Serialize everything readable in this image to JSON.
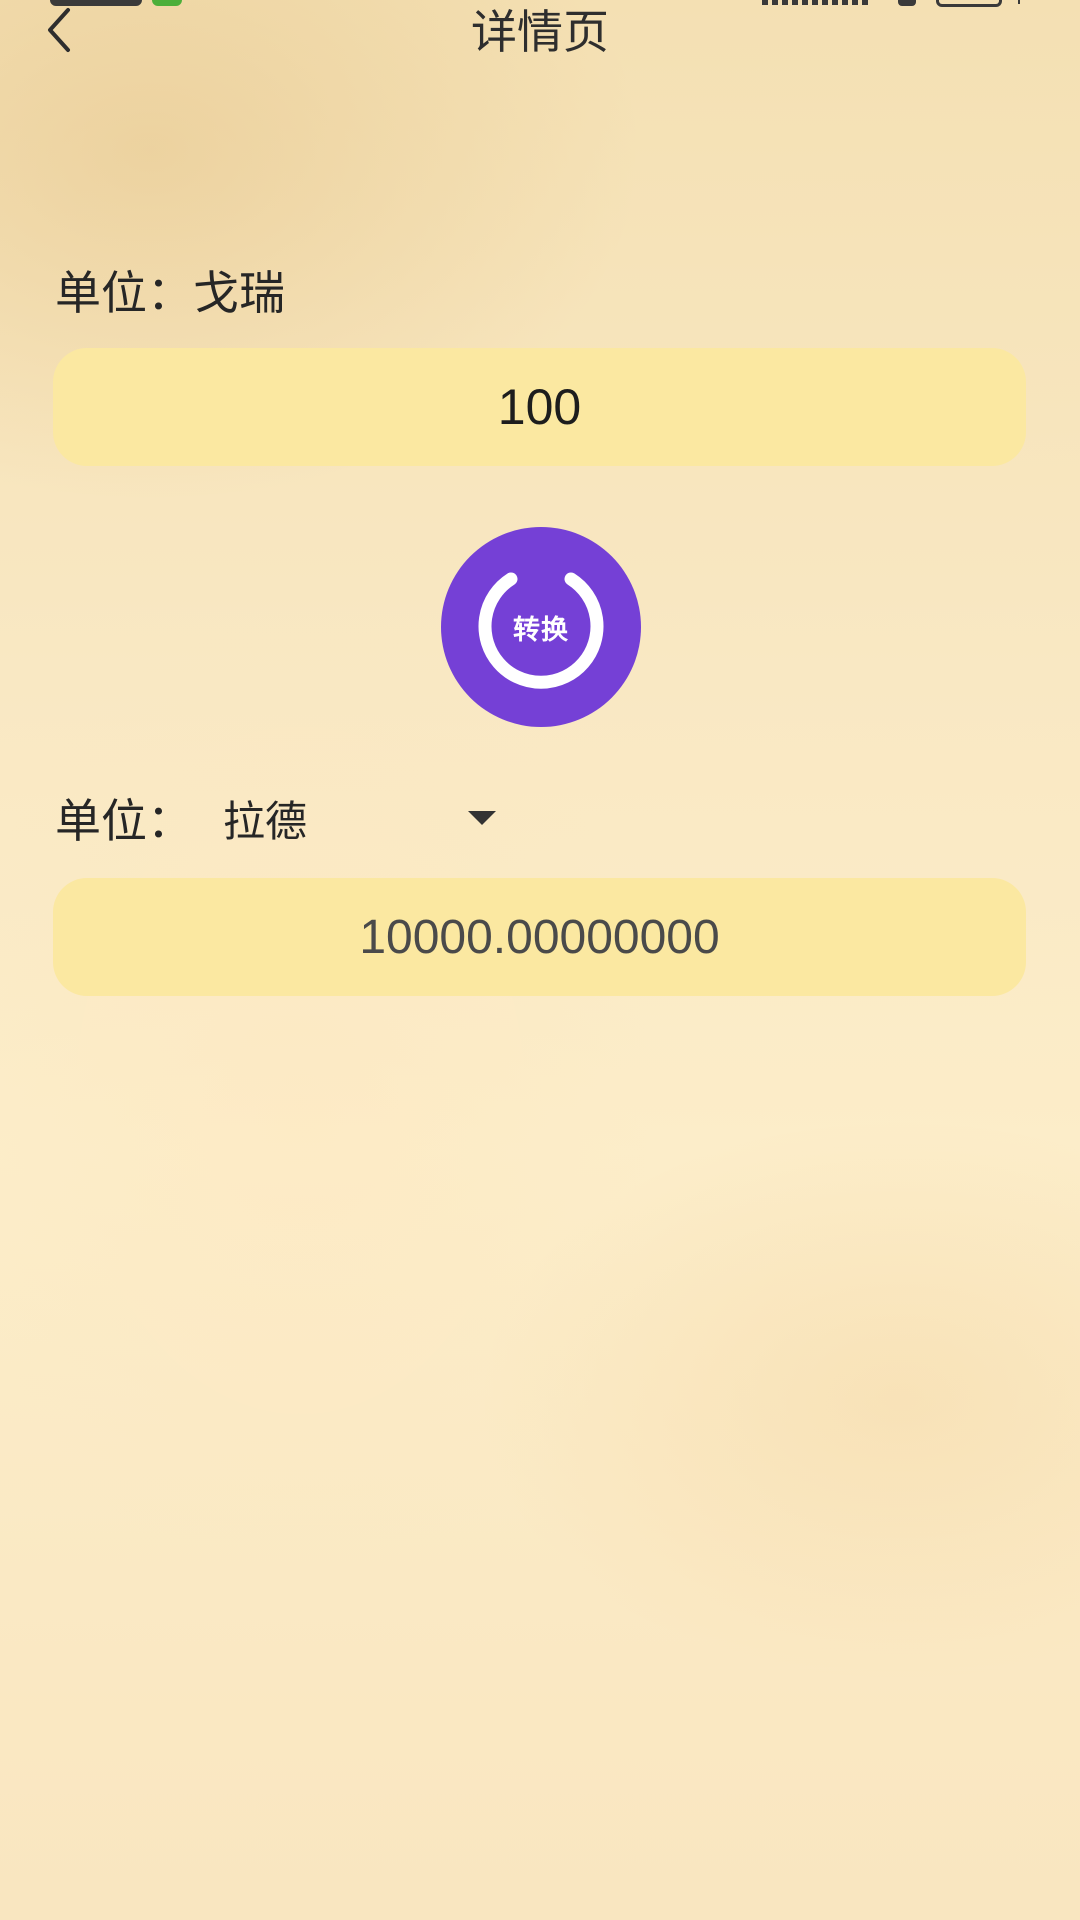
{
  "header": {
    "title": "详情页",
    "back_icon": "chevron-left-icon"
  },
  "source": {
    "unit_prefix": "单位：",
    "unit_name": "戈瑞",
    "value": "100"
  },
  "convert_button": {
    "label": "转换",
    "color": "#7540d6"
  },
  "target": {
    "unit_prefix": "单位：",
    "selected_unit": "拉德",
    "value": "10000.00000000"
  },
  "colors": {
    "field_bg": "#fbe8a1",
    "status_green": "#4caf3a"
  }
}
